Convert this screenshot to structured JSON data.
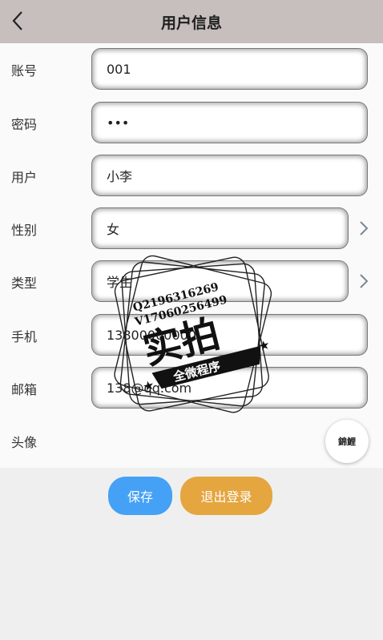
{
  "header": {
    "title": "用户信息",
    "back_icon": "chevron-left-icon"
  },
  "fields": [
    {
      "label": "账号",
      "value": "001"
    },
    {
      "label": "密码",
      "value": "•••"
    },
    {
      "label": "用户",
      "value": "小李"
    },
    {
      "label": "性别",
      "value": "女"
    },
    {
      "label": "类型",
      "value": "学生"
    },
    {
      "label": "手机",
      "value": "13800000000"
    },
    {
      "label": "邮箱",
      "value": "138@qq.com"
    },
    {
      "label": "头像",
      "value": ""
    }
  ],
  "avatar": {
    "text": "錦鯉"
  },
  "buttons": {
    "save": "保存",
    "logout": "退出登录"
  },
  "watermark": {
    "line1": "Q2196316269",
    "line2": "V17060256499",
    "main": "实拍",
    "sub": "全微程序"
  },
  "colors": {
    "header_bg": "#c6bfbe",
    "save_btn": "#44a1f5",
    "logout_btn": "#e5a53f"
  }
}
